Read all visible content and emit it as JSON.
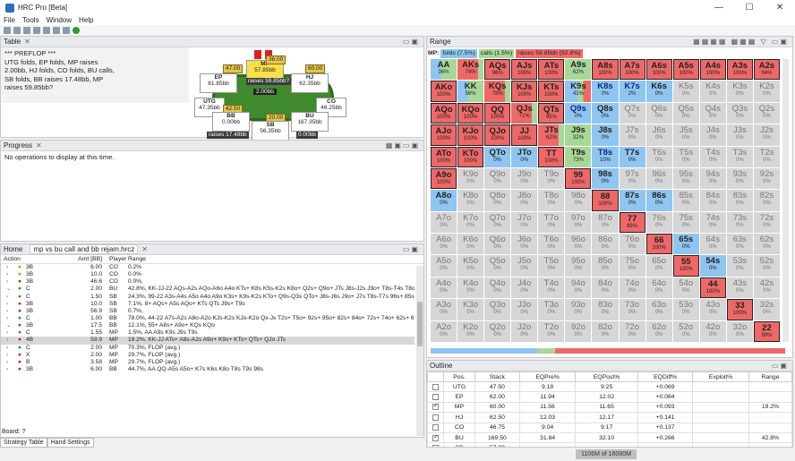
{
  "window": {
    "title": "HRC Pro [Beta]",
    "controls": [
      "—",
      "☐",
      "✕"
    ]
  },
  "menu": [
    "File",
    "Tools",
    "Window",
    "Help"
  ],
  "table_panel": {
    "tab": "Table",
    "history": [
      "*** PREFLOP ***",
      "UTG folds, EP folds, MP raises",
      "2.00bb, HJ folds, CO folds, BU calls,",
      "SB folds, BB raises 17.48bb, MP",
      "raises 59.85bb?"
    ],
    "seats": [
      {
        "name": "MP",
        "stack": "57.85bb",
        "bet": "36.00",
        "action": "raises 59.85bb?",
        "highlight": true
      },
      {
        "name": "EP",
        "stack": "61.85bb",
        "bet": "47.00"
      },
      {
        "name": "HJ",
        "stack": "62.35bb",
        "bet": "60.00"
      },
      {
        "name": "UTG",
        "stack": "47.35bb",
        "bet": ""
      },
      {
        "name": "CO",
        "stack": "46.25bb",
        "bet": ""
      },
      {
        "name": "BB",
        "stack": "0.00bb",
        "bet": "42.50",
        "action": "raises 17.48bb"
      },
      {
        "name": "BU",
        "stack": "167.35bb",
        "bet": "20.00"
      },
      {
        "name": "SB",
        "stack": "56.35bb",
        "bet": ""
      }
    ],
    "pot": "2.00bb",
    "chips_extra": [
      "0.00bb",
      "2.00bb"
    ]
  },
  "progress_panel": {
    "tab": "Progress",
    "message": "No operations to display at this time."
  },
  "tree_panel": {
    "tabs": [
      "Home",
      "mp vs bu call and bb rejam.hrcz"
    ],
    "headers": {
      "action": "Action",
      "amt": "Amt [BB]",
      "player": "Player",
      "range": "Range"
    },
    "rows": [
      {
        "arrow": "›",
        "dot": "●",
        "dc": "dot-o",
        "act": "3B",
        "amt": "6.00",
        "pl": "CO",
        "rng": "0.2%"
      },
      {
        "arrow": "›",
        "dot": "●",
        "dc": "dot-o",
        "act": "3B",
        "amt": "10.0",
        "pl": "CO",
        "rng": "0.0%"
      },
      {
        "arrow": "›",
        "dot": "●",
        "dc": "dot-r",
        "act": "3B",
        "amt": "46.6",
        "pl": "CO",
        "rng": "0.0%,"
      },
      {
        "arrow": "⌄",
        "dot": "●",
        "dc": "dot-c",
        "act": "C",
        "amt": "2.00",
        "pl": "BU",
        "rng": "42.8%, KK-JJ-22 AQs-A2s AQo-A6o A4o KTs+ K8s K5s-K2s K8o+ Q2s+ Q9o+ JTs J8s-J2s J9o+ T8s-T4s T8o+ 97s+..."
      },
      {
        "arrow": "›",
        "dot": "●",
        "dc": "dot-c",
        "act": "C",
        "amt": "1.50",
        "pl": "SB",
        "rng": "24.3%, 99-22 A3s-A4s A5o A4o A9o K3s+ K9s-K2s KTo+ Q9s-Q3s QTo+ J8s-J6s J9o+ J7s T8s-T7s 96s+ 85s+ 74s+..."
      },
      {
        "arrow": "›",
        "dot": "●",
        "dc": "dot-r",
        "act": "3B",
        "amt": "10.0",
        "pl": "SB",
        "rng": "7.1%, 8+ AQs+ A5s AQo+ KTs QTs J9s+ T9s"
      },
      {
        "arrow": "›",
        "dot": "●",
        "dc": "dot-r",
        "act": "3B",
        "amt": "56.9",
        "pl": "SB",
        "rng": "0.7%,"
      },
      {
        "arrow": "›",
        "dot": "●",
        "dc": "dot-c",
        "act": "C",
        "amt": "1.00",
        "pl": "BB",
        "rng": "78.0%, 44-22 A7s-A2s A8o-A2o KJs-K2s KJo-K2o Qx-Jx T2s+ T5o+ 92s+ 95o+ 82s+ 84o+ 72s+ 74o+ 62s+ 63o+..."
      },
      {
        "arrow": "⌄",
        "dot": "●",
        "dc": "dot-r",
        "act": "3B",
        "amt": "17.5",
        "pl": "BB",
        "rng": "12.1%, 55+ A8s+ A9o+ KQs KQo"
      },
      {
        "arrow": "›",
        "dot": "●",
        "dc": "dot-c",
        "act": "C",
        "amt": "1.55",
        "pl": "MP",
        "rng": "1.5%, AA A9s K9s J9s T9s"
      },
      {
        "arrow": "›",
        "dot": "●",
        "dc": "dot-r",
        "act": "4B",
        "amt": "59.9",
        "pl": "MP",
        "rng": "19.2%, KK-JJ ATs+ A8s-A2s A9o+ K9s+ KTs+ QTs+ QJo JTs",
        "sel": true
      },
      {
        "arrow": "›",
        "dot": "●",
        "dc": "dot-b",
        "act": "C",
        "amt": "2.00",
        "pl": "MP",
        "rng": "70.3%, FLOP (avg.)"
      },
      {
        "arrow": "›",
        "dot": "●",
        "dc": "dot-r",
        "act": "X",
        "amt": "2.00",
        "pl": "MP",
        "rng": "29.7%, FLOP (avg.)"
      },
      {
        "arrow": "›",
        "dot": "●",
        "dc": "dot-r",
        "act": "B",
        "amt": "3.58",
        "pl": "MP",
        "rng": "29.7%, FLOP (avg.)"
      },
      {
        "arrow": "›",
        "dot": "●",
        "dc": "dot-r",
        "act": "3B",
        "amt": "6.00",
        "pl": "BB",
        "rng": "44.7%, AA QQ-A5s A5o+ K7s K6s K8o T8s T9s 98s"
      }
    ],
    "board_label": "Board: ?",
    "bottom_tabs": [
      "Strategy Table",
      "Hand Settings"
    ]
  },
  "range_panel": {
    "tab": "Range",
    "player": "MP:",
    "folds": "folds (7.5%)",
    "calls": "calls (1.5%)",
    "raises": "raises 59.85bb (92.8%)"
  },
  "outline_panel": {
    "tab": "Outline",
    "headers": [
      "",
      "Pos.",
      "Stack",
      "EQPre%",
      "EQPost%",
      "EQDiff%",
      "Exploit%",
      "Range"
    ],
    "rows": [
      {
        "checked": false,
        "pos": "UTG",
        "stack": "47.50",
        "pre": "9.18",
        "post": "9.25",
        "diff": "+0.069",
        "exploit": "",
        "range": ""
      },
      {
        "checked": false,
        "pos": "EP",
        "stack": "62.00",
        "pre": "11.94",
        "post": "12.02",
        "diff": "+0.084",
        "exploit": "",
        "range": ""
      },
      {
        "checked": true,
        "pos": "MP",
        "stack": "60.00",
        "pre": "11.56",
        "post": "11.65",
        "diff": "+0.093",
        "exploit": "",
        "range": "19.2%"
      },
      {
        "checked": false,
        "pos": "HJ",
        "stack": "62.50",
        "pre": "12.03",
        "post": "12.17",
        "diff": "+0.141",
        "exploit": "",
        "range": ""
      },
      {
        "checked": false,
        "pos": "CO",
        "stack": "46.75",
        "pre": "9.04",
        "post": "9.17",
        "diff": "+0.137",
        "exploit": "",
        "range": ""
      },
      {
        "checked": true,
        "pos": "BU",
        "stack": "169.50",
        "pre": "31.84",
        "post": "32.10",
        "diff": "+0.266",
        "exploit": "",
        "range": "42.8%"
      },
      {
        "checked": false,
        "pos": "SB",
        "stack": "57.00",
        "pre": "",
        "post": "",
        "diff": "",
        "exploit": "",
        "range": ""
      }
    ]
  },
  "status": {
    "memory": "1106M of 16080M"
  },
  "grid": [
    [
      "AA|36%|mix",
      "AKs|74%|mixr",
      "AQs|96%|red",
      "AJs|100%|red",
      "ATs|100%|red",
      "A9s|62%|green",
      "A8s|100%|red",
      "A7s|100%|red",
      "A6s|100%|red",
      "A5s|100%|red",
      "A4s|100%|red",
      "A3s|100%|red",
      "A2s|94%|red"
    ],
    [
      "AKo|100%|red",
      "KK|56%|mix",
      "KQs|78%|mixr",
      "KJs|100%|red",
      "KTs|100%|red",
      "K9s|41%|mixb2",
      "K8s|0%|blue navy",
      "K7s|2%|blue navy",
      "K6s|0%|blue",
      "K5s|0%|empty",
      "K4s|0%|empty",
      "K3s|0%|empty",
      "K2s|0%|empty"
    ],
    [
      "AQo|100%|red",
      "KQo|100%|red",
      "QQ|100%|red",
      "QJs|71%|mixr",
      "QTs|95%|red",
      "Q9s|0%|blue navy",
      "Q8s|0%|blue",
      "Q7s|0%|empty",
      "Q6s|0%|empty",
      "Q5s|0%|empty",
      "Q4s|0%|empty",
      "Q3s|0%|empty",
      "Q2s|0%|empty"
    ],
    [
      "AJo|100%|red",
      "KJo|100%|red",
      "QJo|100%|red",
      "JJ|100%|red",
      "JTs|62%|mixr",
      "J9s|32%|green",
      "J8s|0%|blue",
      "J7s|0%|empty",
      "J6s|0%|empty",
      "J5s|0%|empty",
      "J4s|0%|empty",
      "J3s|0%|empty",
      "J2s|0%|empty"
    ],
    [
      "ATo|100%|red",
      "KTo|100%|red",
      "QTo|0%|blue",
      "JTo|0%|blue",
      "TT|100%|red",
      "T9s|73%|green",
      "T8s|10%|blue navy",
      "T7s|0%|blue",
      "T6s|0%|empty",
      "T5s|0%|empty",
      "T4s|0%|empty",
      "T3s|0%|empty",
      "T2s|0%|empty"
    ],
    [
      "A9o|100%|red",
      "K9o|0%|empty",
      "Q9o|0%|empty",
      "J9o|0%|empty",
      "T9o|0%|empty",
      "99|100%|red",
      "98s|0%|blue",
      "97s|0%|empty",
      "96s|0%|empty",
      "95s|0%|empty",
      "94s|0%|empty",
      "93s|0%|empty",
      "92s|0%|empty"
    ],
    [
      "A8o|0%|blue",
      "K8o|0%|empty",
      "Q8o|0%|empty",
      "J8o|0%|empty",
      "T8o|0%|empty",
      "98o|0%|empty",
      "88|100%|red",
      "87s|0%|blue",
      "86s|0%|blue",
      "85s|0%|empty",
      "84s|0%|empty",
      "83s|0%|empty",
      "82s|0%|empty"
    ],
    [
      "A7o|0%|empty",
      "K7o|0%|empty",
      "Q7o|0%|empty",
      "J7o|0%|empty",
      "T7o|0%|empty",
      "97o|0%|empty",
      "87o|0%|empty",
      "77|89%|red",
      "76s|0%|empty",
      "75s|0%|empty",
      "74s|0%|empty",
      "73s|0%|empty",
      "72s|0%|empty"
    ],
    [
      "A6o|0%|empty",
      "K6o|0%|empty",
      "Q6o|0%|empty",
      "J6o|0%|empty",
      "T6o|0%|empty",
      "96o|0%|empty",
      "86o|0%|empty",
      "76o|0%|empty",
      "66|100%|red",
      "65s|0%|blue",
      "64s|0%|empty",
      "63s|0%|empty",
      "62s|0%|empty"
    ],
    [
      "A5o|0%|empty",
      "K5o|0%|empty",
      "Q5o|0%|empty",
      "J5o|0%|empty",
      "T5o|0%|empty",
      "95o|0%|empty",
      "85o|0%|empty",
      "75o|0%|empty",
      "65o|0%|empty",
      "55|100%|red",
      "54s|0%|blue",
      "53s|0%|empty",
      "52s|0%|empty"
    ],
    [
      "A4o|0%|empty",
      "K4o|0%|empty",
      "Q4o|0%|empty",
      "J4o|0%|empty",
      "T4o|0%|empty",
      "94o|0%|empty",
      "84o|0%|empty",
      "74o|0%|empty",
      "64o|0%|empty",
      "54o|0%|empty",
      "44|100%|red",
      "43s|0%|empty",
      "42s|0%|empty"
    ],
    [
      "A3o|0%|empty",
      "K3o|0%|empty",
      "Q3o|0%|empty",
      "J3o|0%|empty",
      "T3o|0%|empty",
      "93o|0%|empty",
      "83o|0%|empty",
      "73o|0%|empty",
      "63o|0%|empty",
      "53o|0%|empty",
      "43o|0%|empty",
      "33|100%|red",
      "32s|0%|empty"
    ],
    [
      "A2o|0%|empty",
      "K2o|0%|empty",
      "Q2o|0%|empty",
      "J2o|0%|empty",
      "T2o|0%|empty",
      "92o|0%|empty",
      "82o|0%|empty",
      "72o|0%|empty",
      "62o|0%|empty",
      "52o|0%|empty",
      "42o|0%|empty",
      "32o|0%|empty",
      "22|99%|red"
    ]
  ],
  "colors": {
    "raise": "#ee6868",
    "call": "#a8d898",
    "fold": "#8fc5f1",
    "empty": "#d6d6d6"
  }
}
